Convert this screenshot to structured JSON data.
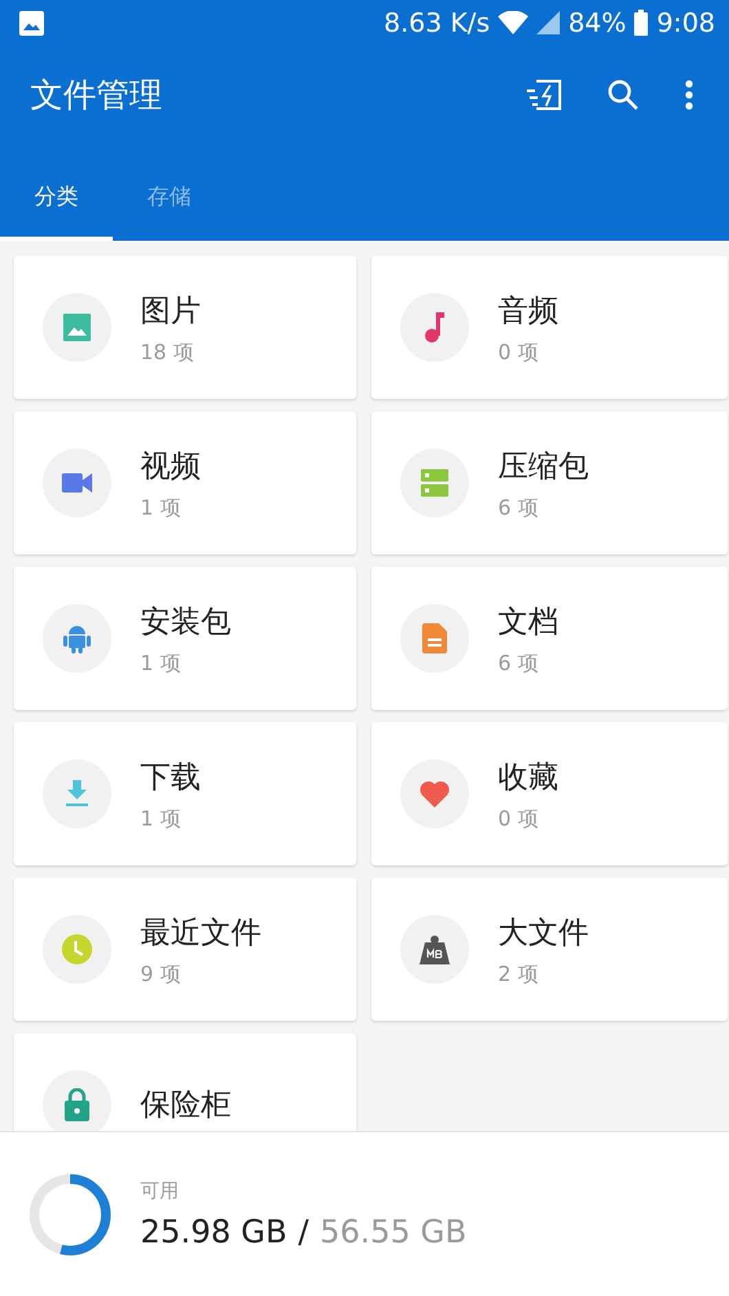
{
  "status_bar": {
    "speed": "8.63 K/s",
    "battery": "84%",
    "time": "9:08"
  },
  "toolbar": {
    "title": "文件管理"
  },
  "tabs": [
    {
      "label": "分类",
      "selected": true
    },
    {
      "label": "存储",
      "selected": false
    }
  ],
  "categories": [
    {
      "kind": "image",
      "name": "图片",
      "count": "18 项",
      "color": "#3dbb9f"
    },
    {
      "kind": "audio",
      "name": "音频",
      "count": "0 项",
      "color": "#e2366d"
    },
    {
      "kind": "video",
      "name": "视频",
      "count": "1 项",
      "color": "#5a78e8"
    },
    {
      "kind": "archive",
      "name": "压缩包",
      "count": "6 项",
      "color": "#8cc63f"
    },
    {
      "kind": "apk",
      "name": "安装包",
      "count": "1 项",
      "color": "#3b8fe0"
    },
    {
      "kind": "document",
      "name": "文档",
      "count": "6 项",
      "color": "#f0883a"
    },
    {
      "kind": "download",
      "name": "下载",
      "count": "1 项",
      "color": "#4cc4d9"
    },
    {
      "kind": "favorite",
      "name": "收藏",
      "count": "0 项",
      "color": "#ef5a4c"
    },
    {
      "kind": "recent",
      "name": "最近文件",
      "count": "9 项",
      "color": "#c6d62e"
    },
    {
      "kind": "large",
      "name": "大文件",
      "count": "2 项",
      "color": "#555555"
    },
    {
      "kind": "safe",
      "name": "保险柜",
      "color": "#22a38a"
    }
  ],
  "storage": {
    "label": "可用",
    "free": "25.98 GB",
    "separator": "/",
    "total": "56.55 GB",
    "level": 0.54
  }
}
